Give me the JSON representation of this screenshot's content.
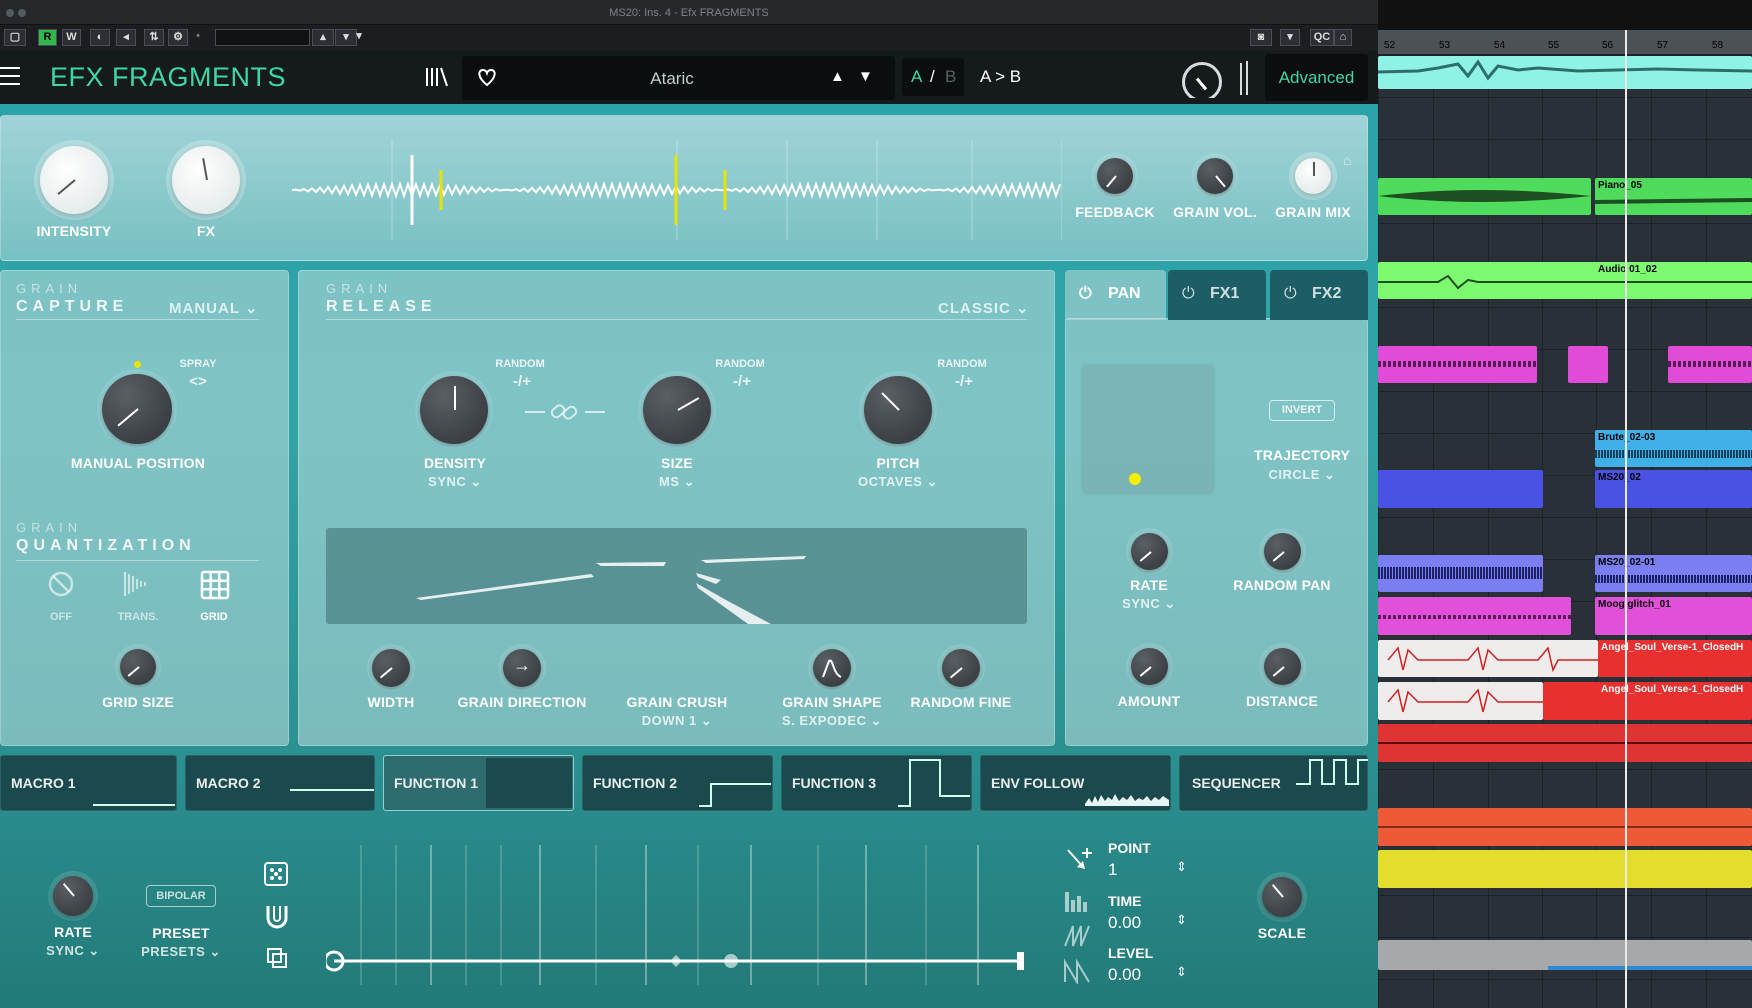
{
  "host": {
    "window_title": "MS20: Ins. 4 - Efx FRAGMENTS",
    "toolbar_buttons": [
      "R",
      "W",
      "QC"
    ]
  },
  "plugin": {
    "brand": "EFX FRAGMENTS",
    "preset_name": "Ataric",
    "ab": {
      "a": "A",
      "slash": "/",
      "b": "B",
      "copy": "A > B"
    },
    "advanced_label": "Advanced",
    "top": {
      "intensity": "INTENSITY",
      "fx": "FX",
      "feedback": "FEEDBACK",
      "grain_vol": "GRAIN VOL.",
      "grain_mix": "GRAIN MIX"
    },
    "capture": {
      "title_small": "GRAIN",
      "title": "CAPTURE",
      "mode": "MANUAL",
      "spray": "SPRAY",
      "spray_symbol": "<>",
      "knob": "MANUAL POSITION"
    },
    "quantization": {
      "title_small": "GRAIN",
      "title": "QUANTIZATION",
      "options": [
        "OFF",
        "TRANS.",
        "GRID"
      ],
      "grid_size": "GRID SIZE"
    },
    "release": {
      "title_small": "GRAIN",
      "title": "RELEASE",
      "mode": "CLASSIC",
      "random": "RANDOM",
      "random_symbol": "-/+",
      "density": {
        "label": "DENSITY",
        "sub": "SYNC"
      },
      "size": {
        "label": "SIZE",
        "sub": "MS"
      },
      "pitch": {
        "label": "PITCH",
        "sub": "OCTAVES"
      },
      "width": "WIDTH",
      "grain_direction": "GRAIN DIRECTION",
      "grain_crush": {
        "label": "GRAIN CRUSH",
        "sub": "DOWN 1"
      },
      "grain_shape": {
        "label": "GRAIN SHAPE",
        "sub": "S. EXPODEC"
      },
      "random_fine": "RANDOM FINE"
    },
    "pan": {
      "tabs": [
        "PAN",
        "FX1",
        "FX2"
      ],
      "invert": "INVERT",
      "trajectory": "TRAJECTORY",
      "trajectory_value": "CIRCLE",
      "rate": "RATE",
      "rate_sub": "SYNC",
      "random_pan": "RANDOM PAN",
      "amount": "AMOUNT",
      "distance": "DISTANCE"
    },
    "mod_tabs": [
      "MACRO 1",
      "MACRO 2",
      "FUNCTION 1",
      "FUNCTION 2",
      "FUNCTION 3",
      "ENV FOLLOW",
      "SEQUENCER"
    ],
    "function": {
      "rate": "RATE",
      "rate_sub": "SYNC",
      "bipolar": "BIPOLAR",
      "preset": "PRESET",
      "preset_sub": "PRESETS",
      "point_label": "POINT",
      "point_value": "1",
      "time_label": "TIME",
      "time_value": "0.00",
      "level_label": "LEVEL",
      "level_value": "0.00",
      "scale": "SCALE"
    }
  },
  "daw": {
    "bars": [
      "52",
      "53",
      "54",
      "55",
      "56",
      "57",
      "58"
    ],
    "clips": [
      "Piano_05",
      "Audio 01_02",
      "Brute_02-03",
      "MS20_02",
      "MS20_02-01",
      "Moog glitch_01",
      "Angel_Soul_Verse-1_ClosedH",
      "Angel_Soul_Verse-1_ClosedH"
    ]
  },
  "colors": {
    "accent": "#3fd6a6",
    "teal": "#2aa3aa",
    "yellow": "#e7e400"
  }
}
